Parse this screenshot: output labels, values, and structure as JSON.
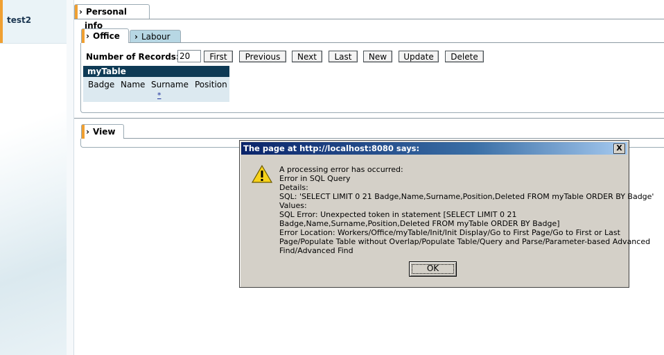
{
  "sidebar": {
    "label": "test2"
  },
  "tabs": {
    "personal": "Personal info",
    "office": "Office",
    "labour": "Labour",
    "view": "View"
  },
  "toolbar": {
    "records_label": "Number of Records:",
    "records_value": "20",
    "buttons": [
      "First",
      "Previous",
      "Next",
      "Last",
      "New",
      "Update",
      "Delete"
    ]
  },
  "table": {
    "title": "myTable",
    "columns": [
      "Badge",
      "Name",
      "Surname",
      "Position"
    ],
    "new_row_link": "*"
  },
  "dialog": {
    "title": "The page at http://localhost:8080 says:",
    "close": "X",
    "lines": [
      "A processing error has occurred:",
      "Error in SQL Query",
      "Details:",
      "SQL: 'SELECT LIMIT 0 21 Badge,Name,Surname,Position,Deleted FROM myTable ORDER BY Badge'",
      "Values:",
      "SQL Error: Unexpected token in statement [SELECT LIMIT 0 21",
      "Badge,Name,Surname,Position,Deleted FROM myTable ORDER BY Badge]",
      "Error Location: Workers/Office/myTable/Init/Init Display/Go to First Page/Go to First or Last",
      "Page/Populate Table without Overlap/Populate Table/Query and Parse/Parameter-based Advanced",
      "Find/Advanced Find"
    ],
    "ok": "OK"
  },
  "icons": {
    "warning": "warning-icon",
    "chevron": "chevron-right-icon"
  }
}
